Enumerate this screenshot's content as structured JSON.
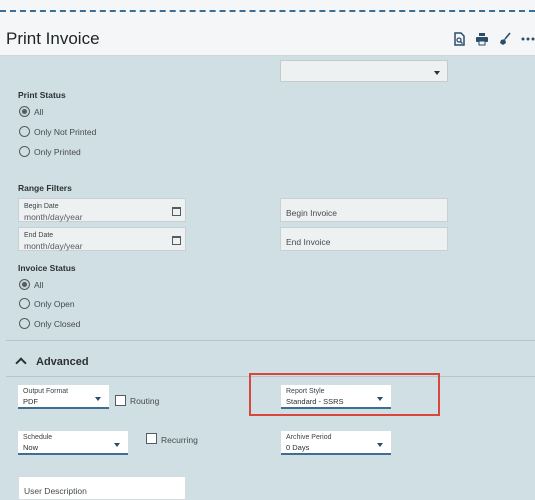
{
  "page": {
    "title": "Print Invoice"
  },
  "header_icons": [
    "preview-icon",
    "print-icon",
    "clear-icon",
    "more-icon"
  ],
  "top_select": {
    "value": ""
  },
  "print_status": {
    "label": "Print Status",
    "options": [
      "All",
      "Only Not Printed",
      "Only Printed"
    ],
    "selected": "All"
  },
  "range_filters": {
    "label": "Range Filters",
    "begin_date": {
      "label": "Begin Date",
      "placeholder": "month/day/year"
    },
    "end_date": {
      "label": "End Date",
      "placeholder": "month/day/year"
    },
    "begin_invoice": {
      "placeholder": "Begin Invoice"
    },
    "end_invoice": {
      "placeholder": "End Invoice"
    }
  },
  "invoice_status": {
    "label": "Invoice Status",
    "options": [
      "All",
      "Only Open",
      "Only Closed"
    ],
    "selected": "All"
  },
  "advanced": {
    "title": "Advanced",
    "output_format": {
      "label": "Output Format",
      "value": "PDF"
    },
    "routing": {
      "label": "Routing",
      "checked": false
    },
    "report_style": {
      "label": "Report Style",
      "value": "Standard - SSRS"
    },
    "schedule": {
      "label": "Schedule",
      "value": "Now"
    },
    "recurring": {
      "label": "Recurring",
      "checked": false
    },
    "archive_period": {
      "label": "Archive Period",
      "value": "0 Days"
    },
    "user_description": {
      "label": "User Description"
    }
  },
  "colors": {
    "accent": "#3c6f93",
    "highlight": "#d9473c",
    "panel": "#d0dfe3"
  }
}
